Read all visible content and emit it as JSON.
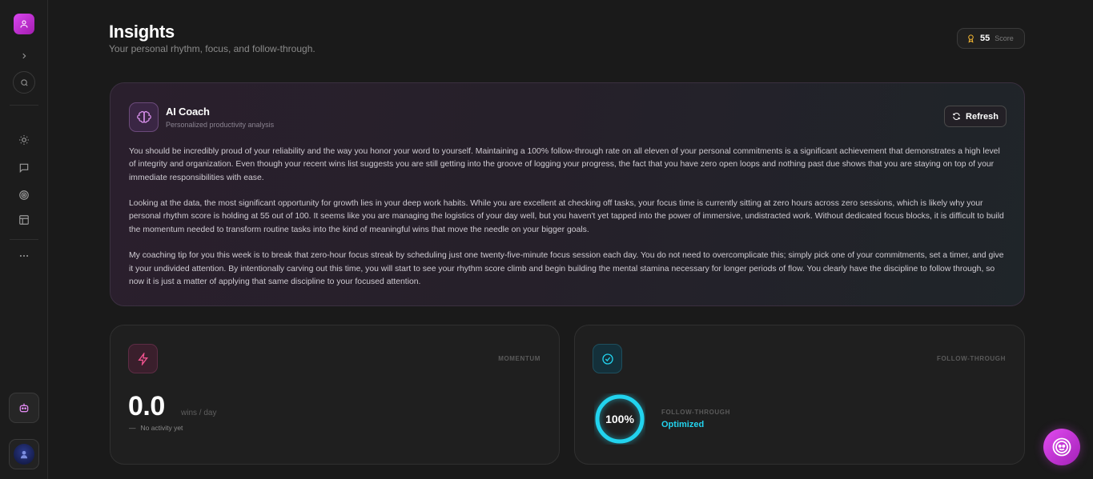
{
  "header": {
    "title": "Insights",
    "subtitle": "Your personal rhythm, focus, and follow-through.",
    "score": {
      "value": "55",
      "label": "Score"
    }
  },
  "sidebar": {
    "icons": [
      "user-icon",
      "chevron-right-icon",
      "search-icon",
      "sun-icon",
      "chat-icon",
      "target-icon",
      "layout-icon",
      "more-icon",
      "bot-icon",
      "user-avatar-icon"
    ]
  },
  "coach": {
    "title": "AI Coach",
    "subtitle": "Personalized productivity analysis",
    "refresh_label": "Refresh",
    "paragraphs": [
      "You should be incredibly proud of your reliability and the way you honor your word to yourself. Maintaining a 100% follow-through rate on all eleven of your personal commitments is a significant achievement that demonstrates a high level of integrity and organization. Even though your recent wins list suggests you are still getting into the groove of logging your progress, the fact that you have zero open loops and nothing past due shows that you are staying on top of your immediate responsibilities with ease.",
      "Looking at the data, the most significant opportunity for growth lies in your deep work habits. While you are excellent at checking off tasks, your focus time is currently sitting at zero hours across zero sessions, which is likely why your personal rhythm score is holding at 55 out of 100. It seems like you are managing the logistics of your day well, but you haven't yet tapped into the power of immersive, undistracted work. Without dedicated focus blocks, it is difficult to build the momentum needed to transform routine tasks into the kind of meaningful wins that move the needle on your bigger goals.",
      "My coaching tip for you this week is to break that zero-hour focus streak by scheduling just one twenty-five-minute focus session each day. You do not need to overcomplicate this; simply pick one of your commitments, set a timer, and give it your undivided attention. By intentionally carving out this time, you will start to see your rhythm score climb and begin building the mental stamina necessary for longer periods of flow. You clearly have the discipline to follow through, so now it is just a matter of applying that same discipline to your focused attention."
    ]
  },
  "momentum": {
    "kicker": "MOMENTUM",
    "value": "0.0",
    "unit": "wins / day",
    "dash": "—",
    "note": "No activity yet"
  },
  "follow_through": {
    "kicker": "FOLLOW-THROUGH",
    "percent_label": "100%",
    "percent": 100,
    "inner_kicker": "FOLLOW-THROUGH",
    "status": "Optimized"
  },
  "colors": {
    "accent_pink": "#d946ef",
    "accent_cyan": "#22d3ee",
    "background": "#1a1a1a"
  }
}
